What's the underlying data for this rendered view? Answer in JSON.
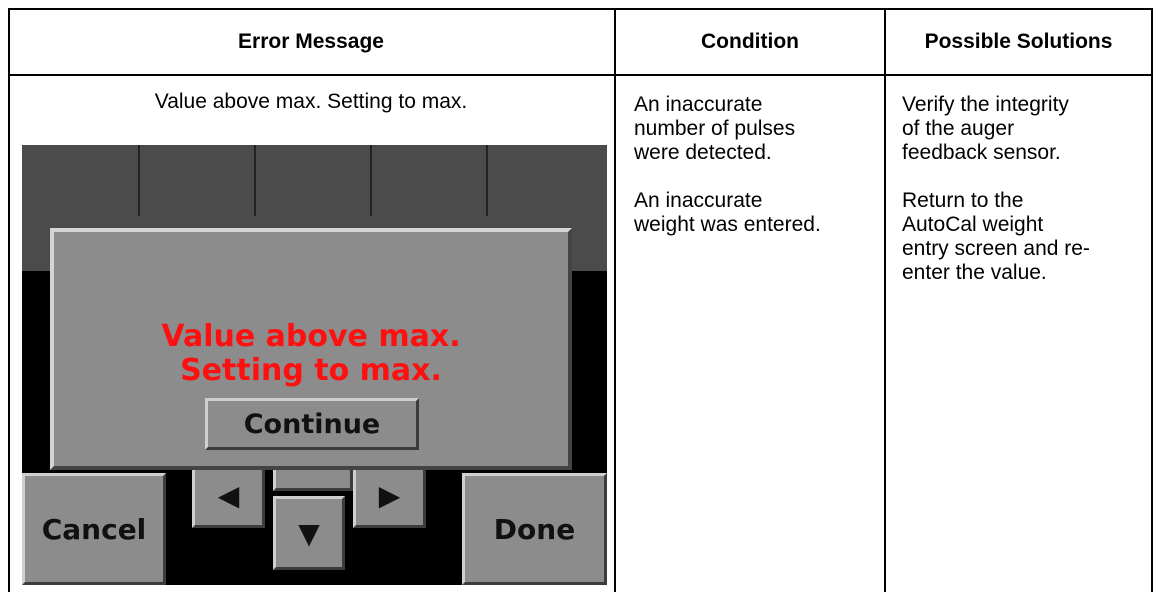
{
  "table": {
    "headers": {
      "error_message": "Error Message",
      "condition": "Condition",
      "possible_solutions": "Possible Solutions"
    },
    "row": {
      "error_caption": "Value above max. Setting to max.",
      "condition_lines": [
        "An inaccurate",
        "number of pulses",
        "were detected.",
        "",
        "An inaccurate",
        "weight was entered."
      ],
      "solution_lines": [
        "Verify the integrity",
        "of the auger",
        "feedback sensor.",
        "",
        "Return to the",
        "AutoCal weight",
        "entry screen and re-",
        "enter the value."
      ]
    }
  },
  "screen": {
    "dialog": {
      "message_line1": "Value above max.",
      "message_line2": "Setting to max.",
      "continue_label": "Continue"
    },
    "cancel_label": "Cancel",
    "done_label": "Done",
    "left_arrow": "◀",
    "right_arrow": "▶",
    "down_arrow": "▼",
    "colors": {
      "message": "#ff1010",
      "button": "#8c8c8c",
      "screen_bg": "#000000",
      "grid": "#4b4b4b"
    },
    "icons": {
      "left": "left-arrow-icon",
      "right": "right-arrow-icon",
      "down": "down-arrow-icon"
    }
  }
}
